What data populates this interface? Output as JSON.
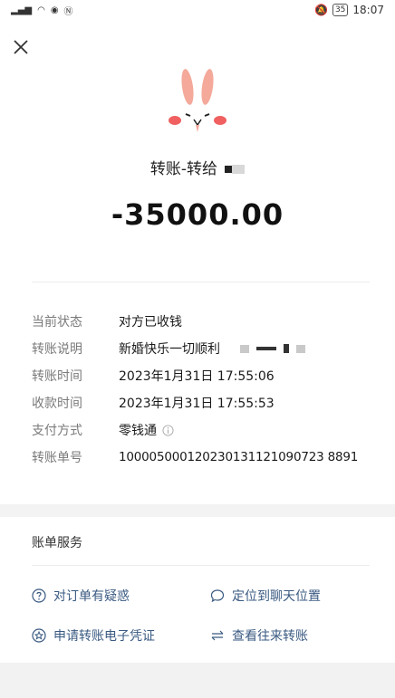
{
  "status_bar": {
    "time": "18:07",
    "battery": "35"
  },
  "header": {
    "title": "转账-转给"
  },
  "transfer": {
    "amount": "-35000.00"
  },
  "details": [
    {
      "label": "当前状态",
      "value": "对方已收钱"
    },
    {
      "label": "转账说明",
      "value": "新婚快乐一切顺利"
    },
    {
      "label": "转账时间",
      "value": "2023年1月31日 17:55:06"
    },
    {
      "label": "收款时间",
      "value": "2023年1月31日 17:55:53"
    },
    {
      "label": "支付方式",
      "value": "零钱通"
    },
    {
      "label": "转账单号",
      "value": "100005000120230131121090723 8891"
    }
  ],
  "services": {
    "title": "账单服务",
    "items": [
      {
        "label": "对订单有疑惑",
        "icon": "question-icon"
      },
      {
        "label": "定位到聊天位置",
        "icon": "chat-bubble-icon"
      },
      {
        "label": "申请转账电子凭证",
        "icon": "certificate-icon"
      },
      {
        "label": "查看往来转账",
        "icon": "transfer-arrows-icon"
      }
    ]
  }
}
